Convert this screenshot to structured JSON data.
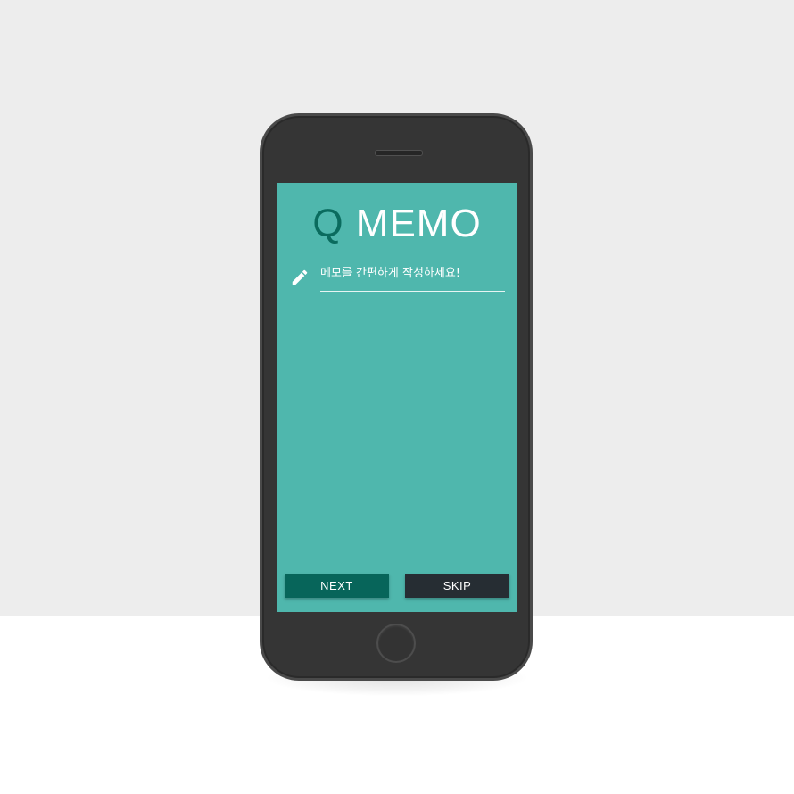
{
  "app": {
    "logo_mark": "Q",
    "logo_text": " MEMO"
  },
  "memo": {
    "placeholder": "메모를 간편하게 작성하세요!",
    "value": "",
    "icon": "pencil-icon"
  },
  "buttons": {
    "next_label": "NEXT",
    "skip_label": "SKIP"
  },
  "colors": {
    "screen_background": "#4fb7ad",
    "logo_accent": "#0a6b5e",
    "next_button": "#07655a",
    "skip_button": "#262d33",
    "device_body": "#353535"
  }
}
